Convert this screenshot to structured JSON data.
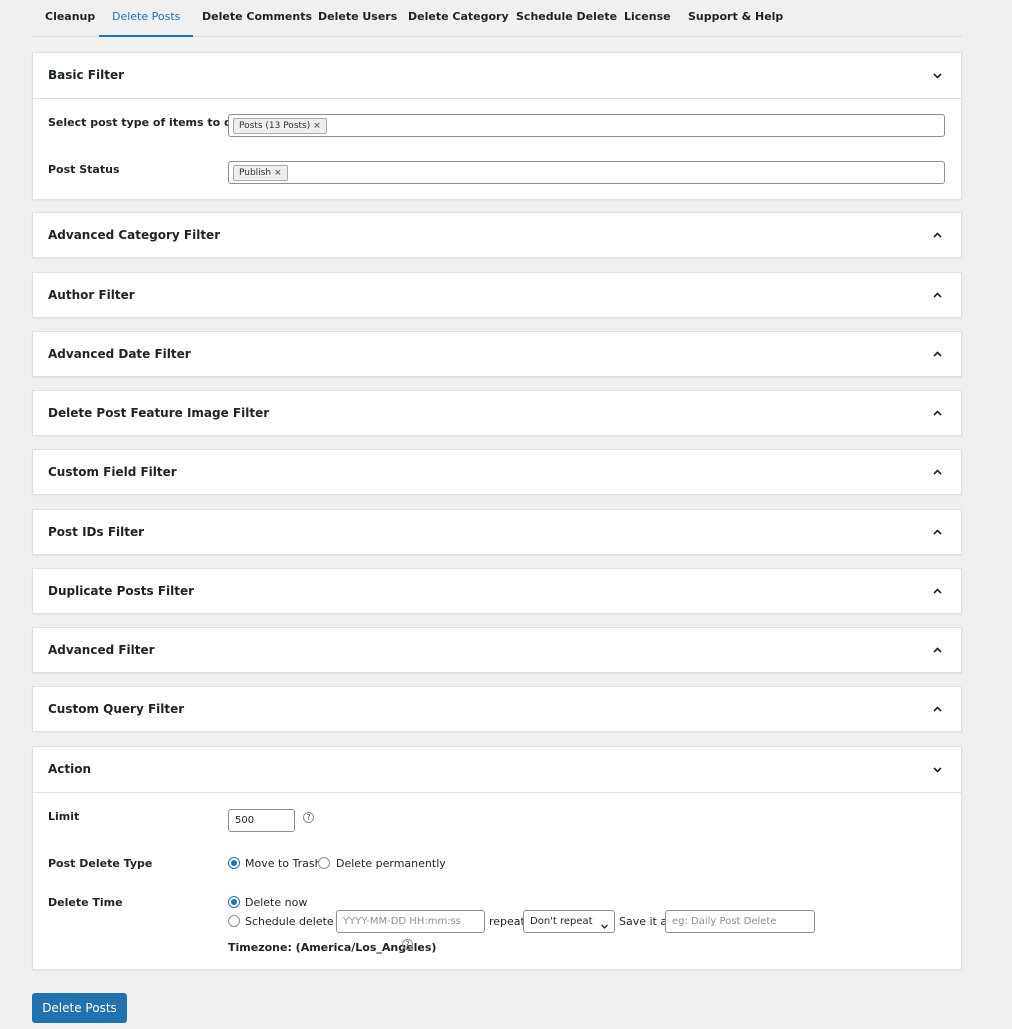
{
  "tabs": [
    "Cleanup",
    "Delete Posts",
    "Delete Comments",
    "Delete Users",
    "Delete Category",
    "Schedule Delete",
    "License",
    "Support & Help"
  ],
  "active_tab": "Delete Posts",
  "basic_filter": {
    "title": "Basic Filter",
    "post_type_label": "Select post type of items to delete",
    "post_type_tag": "Posts (13 Posts)",
    "post_status_label": "Post Status",
    "post_status_tag": "Publish"
  },
  "collapsed_panels": [
    "Advanced Category Filter",
    "Author Filter",
    "Advanced Date Filter",
    "Delete Post Feature Image Filter",
    "Custom Field Filter",
    "Post IDs Filter",
    "Duplicate Posts Filter",
    "Advanced Filter",
    "Custom Query Filter"
  ],
  "action": {
    "title": "Action",
    "limit_label": "Limit",
    "limit_value": "500",
    "delete_type_label": "Post Delete Type",
    "move_to_trash": "Move to Trash",
    "delete_permanently": "Delete permanently",
    "delete_time_label": "Delete Time",
    "delete_now": "Delete now",
    "schedule_delete_at": "Schedule delete at",
    "schedule_placeholder": "YYYY-MM-DD HH:mm:ss",
    "repeat_label": "repeat",
    "repeat_value": "Don't repeat",
    "save_as_label": "Save it as",
    "save_as_placeholder": "eg: Daily Post Delete",
    "timezone": "Timezone: (America/Los_Angeles)"
  },
  "submit_label": "Delete Posts",
  "colors": {
    "accent": "#2271b1",
    "background": "#f0f0f1"
  },
  "icons": [
    "chevron-down-icon",
    "chevron-up-icon",
    "help-icon",
    "close-icon"
  ]
}
